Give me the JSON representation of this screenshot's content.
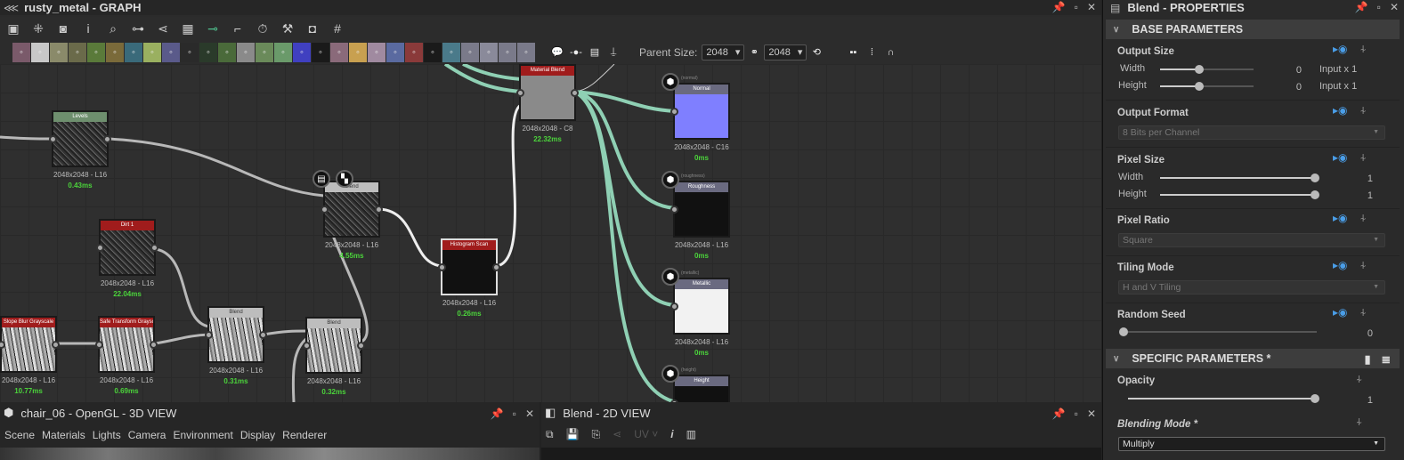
{
  "graph": {
    "title": "rusty_metal - GRAPH",
    "toolbar_row1": [
      "frame-icon",
      "fit-1-1-icon",
      "camera-icon",
      "info-icon",
      "zoom-icon",
      "connect-icon",
      "hierarchy-icon",
      "layers-icon",
      "link-mode-icon",
      "wire-icon",
      "timer-icon",
      "wrench-icon",
      "preview-icon",
      "grid-icon"
    ],
    "toolbar_row2": [
      {
        "name": "bitmap-icon",
        "color": "#7a5a6a"
      },
      {
        "name": "svg-icon",
        "color": "#c8c8c8"
      },
      {
        "name": "uniform-color-icon",
        "color": "#8a8a6a"
      },
      {
        "name": "shuffle-icon",
        "color": "#6a6a4a"
      },
      {
        "name": "curve-icon",
        "color": "#5a7a3a"
      },
      {
        "name": "levels-drop-icon",
        "color": "#7a6a3a"
      },
      {
        "name": "transform-icon",
        "color": "#3a6a7a"
      },
      {
        "name": "gradient-icon",
        "color": "#9ab060"
      },
      {
        "name": "circle-icon",
        "color": "#5a5a8a"
      },
      {
        "name": "tiles-icon",
        "color": "#2a2a2a"
      },
      {
        "name": "emboss-icon",
        "color": "#2a3a2a"
      },
      {
        "name": "warp-icon",
        "color": "#4a6a3a"
      },
      {
        "name": "slider-icon",
        "color": "#8a8a8a"
      },
      {
        "name": "contrast-icon",
        "color": "#6a8a5a"
      },
      {
        "name": "histogram-icon",
        "color": "#6a9a6a"
      },
      {
        "name": "hsl-icon",
        "color": "#4040c0"
      },
      {
        "name": "noise-01-icon",
        "color": "#1a1a1a"
      },
      {
        "name": "fx-map-icon",
        "color": "#8a6a7a"
      },
      {
        "name": "mirror-icon",
        "color": "#c8a050"
      },
      {
        "name": "text-icon",
        "color": "#a08aa0"
      },
      {
        "name": "select-icon",
        "color": "#5a6aa0"
      },
      {
        "name": "fill-icon",
        "color": "#8a3a3a"
      },
      {
        "name": "value-01-icon",
        "color": "#1a1a1a"
      },
      {
        "name": "pattern-icon",
        "color": "#4a7a8a"
      },
      {
        "name": "input-gray-icon",
        "color": "#7a7a8a"
      },
      {
        "name": "input-color-icon",
        "color": "#8a8a9a"
      },
      {
        "name": "input-value-icon",
        "color": "#7a7a8a"
      },
      {
        "name": "output-icon",
        "color": "#7a7a8a"
      }
    ],
    "parent_size_label": "Parent Size:",
    "parent_w": "2048",
    "parent_h": "2048",
    "nodes": {
      "levels": {
        "label": "Levels",
        "res": "2048x2048 - L16",
        "time": "0.43ms",
        "color": "#6e8f6e"
      },
      "dirt": {
        "label": "Dirt 1",
        "res": "2048x2048 - L16",
        "time": "22.04ms",
        "color": "#a01c1c"
      },
      "slope": {
        "label": "Slope Blur Grayscale",
        "res": "2048x2048 - L16",
        "time": "10.77ms",
        "color": "#a01c1c"
      },
      "safe": {
        "label": "Safe Transform Graysc...",
        "res": "2048x2048 - L16",
        "time": "0.69ms",
        "color": "#a01c1c"
      },
      "blend1": {
        "label": "Blend",
        "res": "2048x2048 - L16",
        "time": "0.31ms",
        "color": "#bdbdbd"
      },
      "blend2": {
        "label": "Blend",
        "res": "2048x2048 - L16",
        "time": "0.32ms",
        "color": "#bdbdbd"
      },
      "blend3": {
        "label": "Blend",
        "res": "2048x2048 - L16",
        "time": "4.55ms",
        "color": "#bdbdbd"
      },
      "hist": {
        "label": "Histogram Scan",
        "res": "2048x2048 - L16",
        "time": "0.26ms",
        "color": "#a01c1c"
      },
      "matblend": {
        "label": "Material Blend",
        "res": "2048x2048 - C8",
        "time": "22.32ms",
        "color": "#a01c1c"
      },
      "normal": {
        "label": "Normal",
        "tag": "(normal)",
        "res": "2048x2048 - C16",
        "time": "0ms",
        "color": "#6a6a80"
      },
      "rough": {
        "label": "Roughness",
        "tag": "(roughness)",
        "res": "2048x2048 - L16",
        "time": "0ms",
        "color": "#6a6a80"
      },
      "metal": {
        "label": "Metallic",
        "tag": "(metallic)",
        "res": "2048x2048 - L16",
        "time": "0ms",
        "color": "#6a6a80"
      },
      "height": {
        "label": "Height",
        "tag": "(height)",
        "color": "#6a6a80"
      }
    }
  },
  "props": {
    "title": "Blend - PROPERTIES",
    "base": "BASE PARAMETERS",
    "output_size": "Output Size",
    "width": "Width",
    "height": "Height",
    "os_w": "0",
    "os_h": "0",
    "os_w_mode": "Input x 1",
    "os_h_mode": "Input x 1",
    "output_format": "Output Format",
    "output_format_val": "8 Bits per Channel",
    "pixel_size": "Pixel Size",
    "ps_w": "1",
    "ps_h": "1",
    "pixel_ratio": "Pixel Ratio",
    "pixel_ratio_val": "Square",
    "tiling": "Tiling Mode",
    "tiling_val": "H and V Tiling",
    "seed": "Random Seed",
    "seed_val": "0",
    "specific": "SPECIFIC PARAMETERS *",
    "opacity": "Opacity",
    "opacity_val": "1",
    "blending": "Blending Mode *",
    "blending_val": "Multiply"
  },
  "view3d": {
    "title": "chair_06 - OpenGL - 3D VIEW",
    "menu": [
      "Scene",
      "Materials",
      "Lights",
      "Camera",
      "Environment",
      "Display",
      "Renderer"
    ]
  },
  "view2d": {
    "title": "Blend - 2D VIEW",
    "uv": "UV"
  }
}
